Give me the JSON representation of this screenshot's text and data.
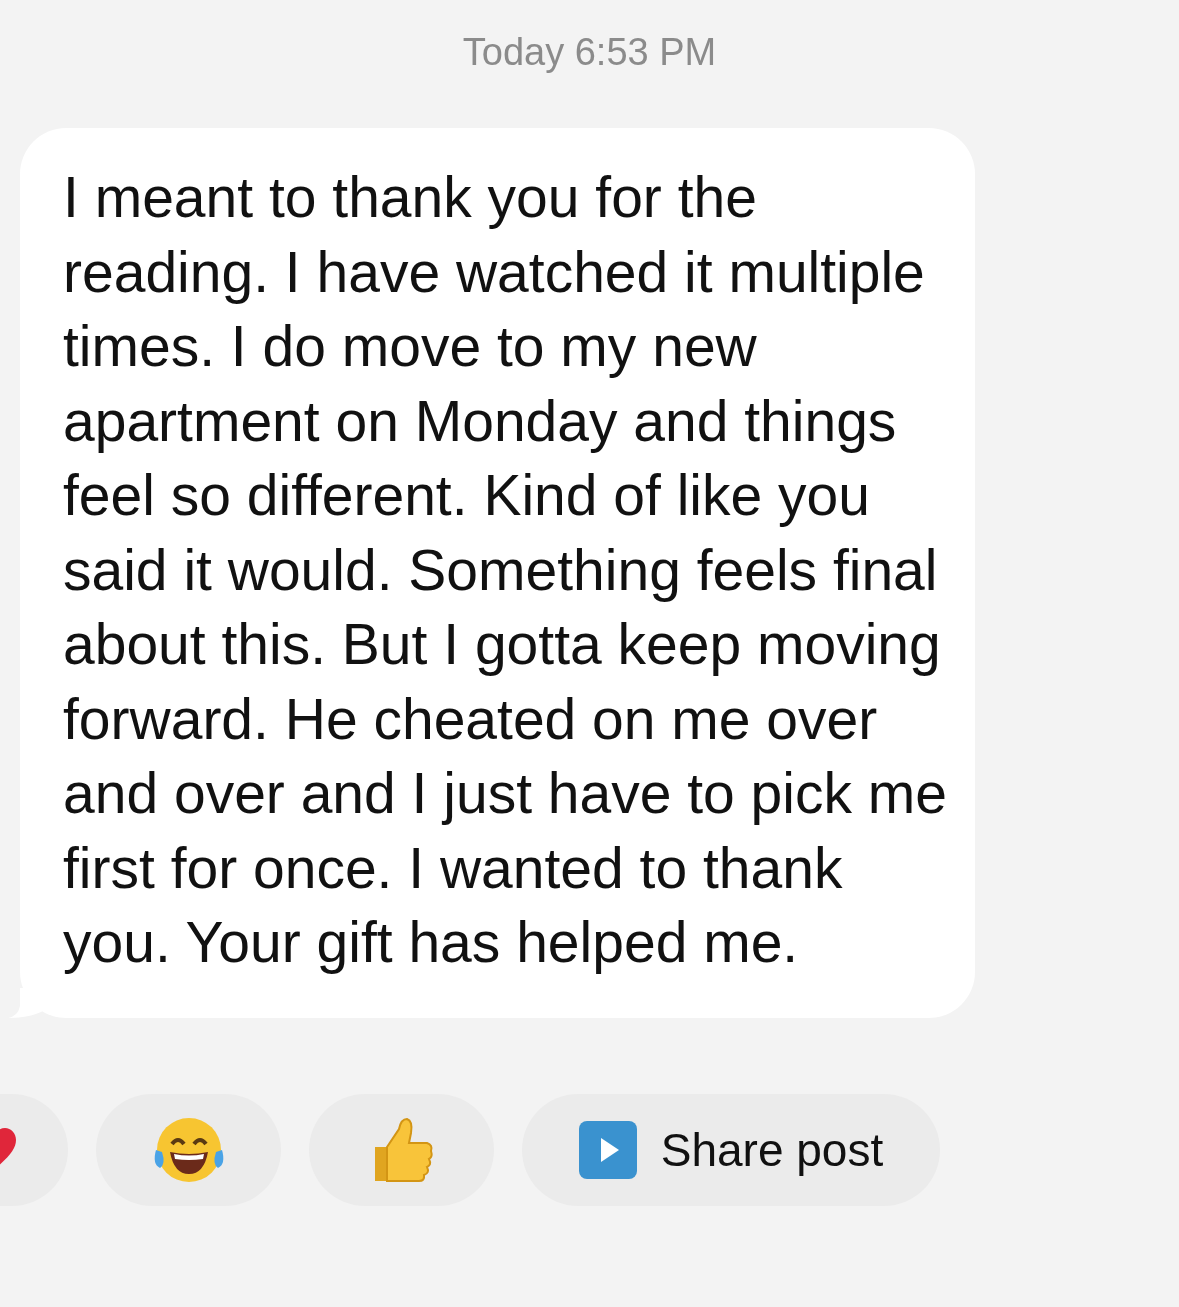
{
  "timestamp": "Today 6:53 PM",
  "message": {
    "text": "I meant to thank you for the reading. I have watched it multiple times. I do move to my new apartment on Monday and things feel so different. Kind of like you said it would. Something feels final about this. But I gotta keep moving forward. He cheated on me over and over and I just have to pick me first for once. I wanted to thank you. Your gift has helped me."
  },
  "reactions": [
    {
      "kind": "heart"
    },
    {
      "kind": "laugh"
    },
    {
      "kind": "thumbs_up"
    }
  ],
  "share_button": {
    "label": "Share post"
  }
}
